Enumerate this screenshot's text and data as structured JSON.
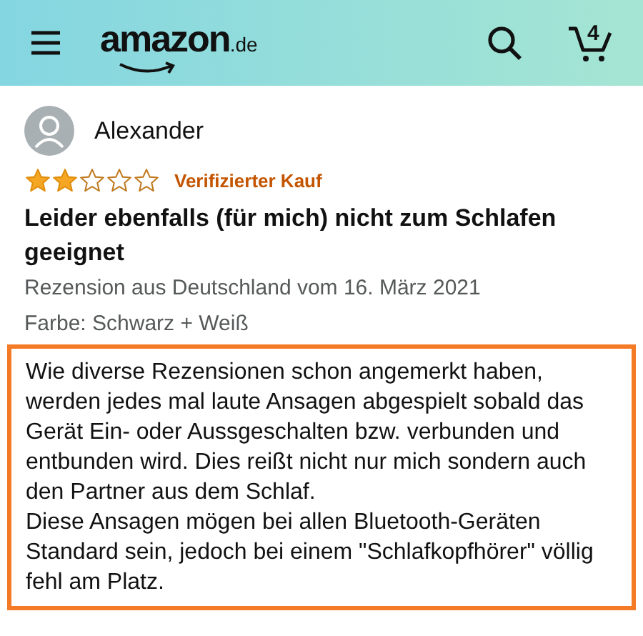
{
  "header": {
    "logo": "amazon",
    "logo_suffix": ".de",
    "cart_count": "4"
  },
  "review": {
    "author": "Alexander",
    "stars": 2,
    "badge": "Verifizierter Kauf",
    "title": "Leider ebenfalls (für mich) nicht zum Schlafen geeignet",
    "meta": "Rezension aus Deutschland vom 16. März 2021",
    "variant": "Farbe: Schwarz + Weiß",
    "highlighted": true,
    "paragraphs": [
      "Wie diverse Rezensionen schon angemerkt haben, werden jedes mal laute Ansagen abgespielt sobald das Gerät Ein- oder Aussgeschalten bzw. verbunden und entbunden wird. Dies reißt nicht nur mich sondern auch den Partner aus dem Schlaf.",
      "Diese Ansagen mögen bei allen Bluetooth-Geräten Standard sein, jedoch bei einem \"Schlafkopfhörer\" völlig fehl am Platz."
    ]
  }
}
